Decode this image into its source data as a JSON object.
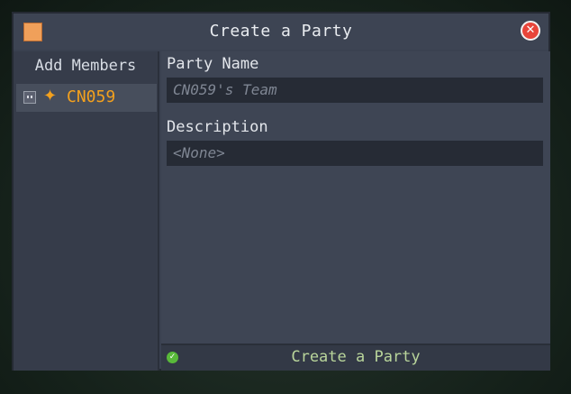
{
  "window": {
    "title": "Create a Party",
    "close_symbol": "✕"
  },
  "sidebar": {
    "title": "Add Members",
    "members": [
      {
        "name": "CN059",
        "icon": "player-head-icon",
        "badge": "star-icon",
        "color": "#f4a11d"
      }
    ]
  },
  "form": {
    "party_name_label": "Party Name",
    "party_name_placeholder": "CN059's Team",
    "description_label": "Description",
    "description_placeholder": "<None>"
  },
  "footer": {
    "create_label": "Create a Party",
    "icon": "check-icon"
  },
  "colors": {
    "accent": "#f4a11d",
    "confirm": "#59b93a",
    "close": "#e8453a"
  }
}
